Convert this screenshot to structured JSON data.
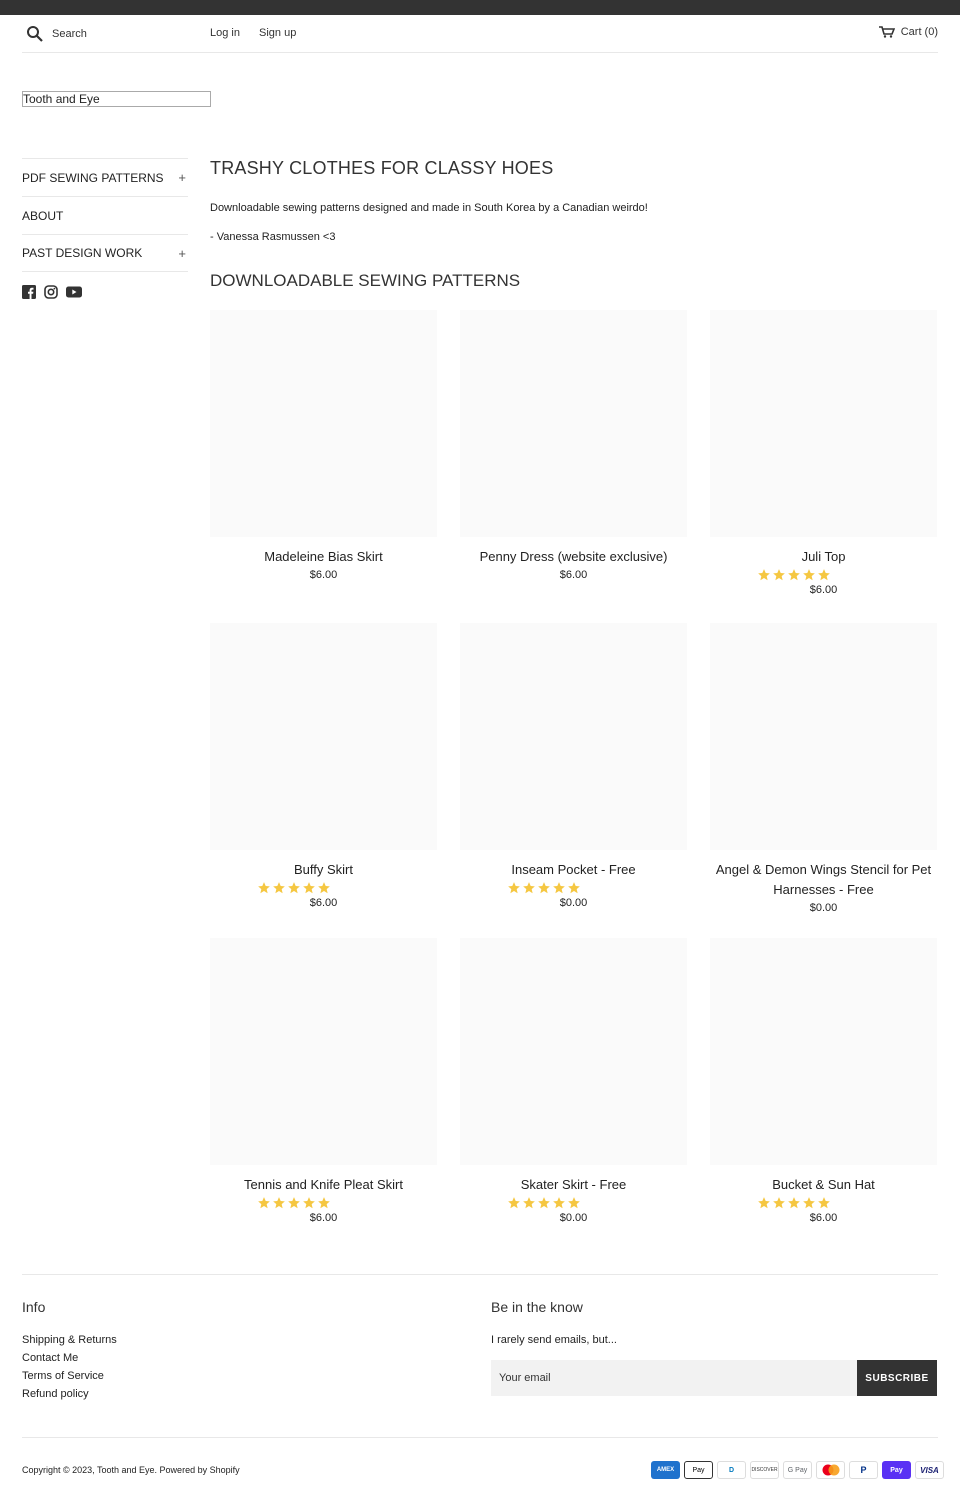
{
  "header": {
    "search_placeholder": "Search",
    "login": "Log in",
    "signup": "Sign up",
    "cart": "Cart (0)"
  },
  "logo": {
    "text": "Tooth and Eye"
  },
  "sidebar": {
    "items": [
      {
        "label": "PDF SEWING PATTERNS",
        "expand": "+"
      },
      {
        "label": "ABOUT",
        "expand": ""
      },
      {
        "label": "PAST DESIGN WORK",
        "expand": "+"
      }
    ],
    "social": [
      "facebook-icon",
      "instagram-icon",
      "youtube-icon"
    ]
  },
  "main": {
    "title": "TRASHY CLOTHES FOR CLASSY HOES",
    "intro1": "Downloadable sewing patterns designed and made in South Korea by a Canadian weirdo!",
    "intro2": "- Vanessa Rasmussen <3",
    "section_title": "DOWNLOADABLE SEWING PATTERNS"
  },
  "products": [
    {
      "title": "Madeleine Bias Skirt",
      "price": "$6.00",
      "stars": 0
    },
    {
      "title": "Penny Dress (website exclusive)",
      "price": "$6.00",
      "stars": 0
    },
    {
      "title": "Juli Top",
      "price": "$6.00",
      "stars": 5
    },
    {
      "title": "Buffy Skirt",
      "price": "$6.00",
      "stars": 5
    },
    {
      "title": "Inseam Pocket - Free",
      "price": "$0.00",
      "stars": 5
    },
    {
      "title": "Angel & Demon Wings Stencil for Pet Harnesses - Free",
      "price": "$0.00",
      "stars": 0
    },
    {
      "title": "Tennis and Knife Pleat Skirt",
      "price": "$6.00",
      "stars": 5
    },
    {
      "title": "Skater Skirt - Free",
      "price": "$0.00",
      "stars": 5
    },
    {
      "title": "Bucket & Sun Hat",
      "price": "$6.00",
      "stars": 5
    }
  ],
  "footer": {
    "info_title": "Info",
    "links": [
      "Shipping & Returns",
      "Contact Me",
      "Terms of Service",
      "Refund policy"
    ],
    "newsletter_title": "Be in the know",
    "newsletter_text": "I rarely send emails, but...",
    "email_placeholder": "Your email",
    "subscribe": "SUBSCRIBE",
    "copyright": "Copyright © 2023, Tooth and Eye. Powered by Shopify",
    "payments": [
      "AMEX",
      "Pay",
      "D",
      "DISCOVER",
      "G Pay",
      "",
      "P",
      "Pay",
      "VISA"
    ]
  },
  "colors": {
    "star": "#f5c742",
    "dark": "#333333",
    "card_bg": "#fafafa"
  }
}
